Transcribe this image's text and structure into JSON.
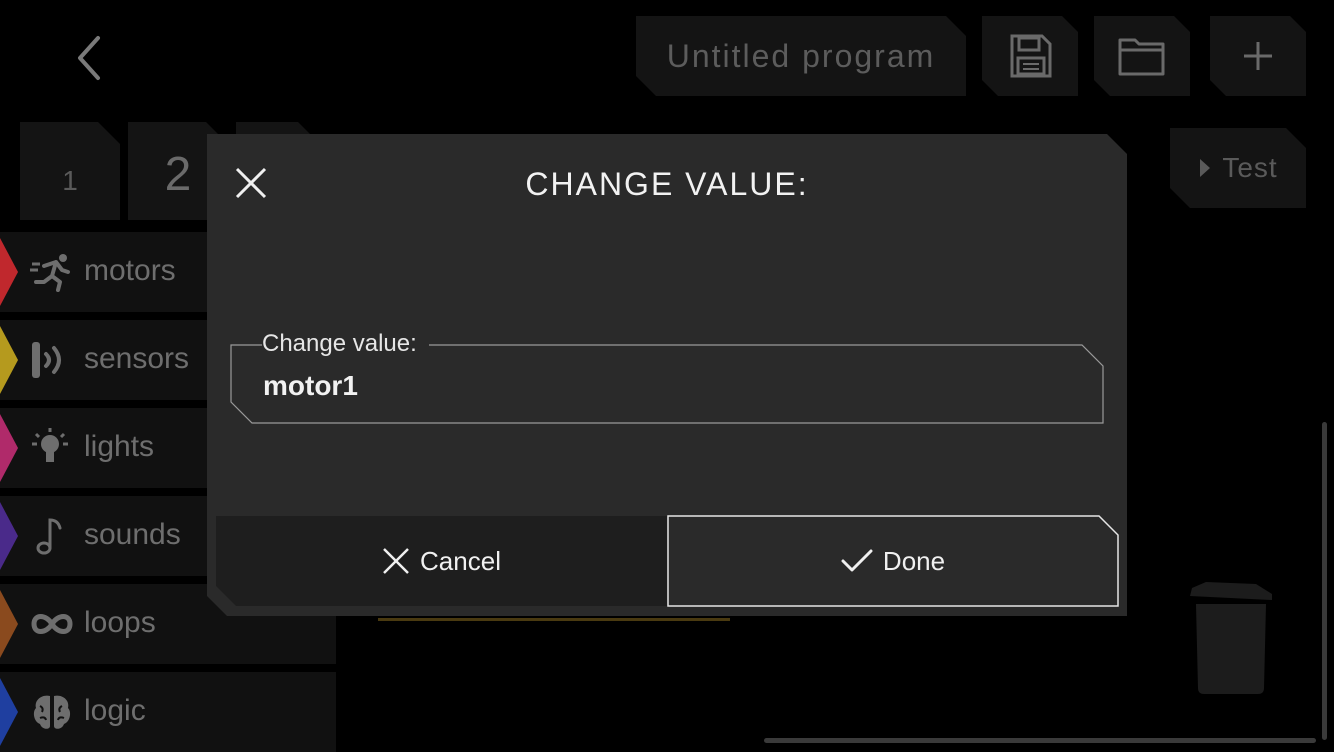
{
  "header": {
    "program_title": "Untitled program",
    "back_icon": "chevron-left-icon",
    "save_icon": "floppy-disk-icon",
    "open_icon": "folder-icon",
    "add_icon": "plus-icon"
  },
  "tabs": [
    {
      "label": "1"
    },
    {
      "label": "2"
    }
  ],
  "test_button": {
    "label": "Test",
    "icon": "play-icon"
  },
  "categories": [
    {
      "label": "motors",
      "icon": "running-person-icon",
      "color": "#c0282d"
    },
    {
      "label": "sensors",
      "icon": "sensor-icon",
      "color": "#b59a1e"
    },
    {
      "label": "lights",
      "icon": "light-bulb-icon",
      "color": "#b02a6a"
    },
    {
      "label": "sounds",
      "icon": "music-note-icon",
      "color": "#4a2a8a"
    },
    {
      "label": "loops",
      "icon": "infinity-icon",
      "color": "#8a4a1e"
    },
    {
      "label": "logic",
      "icon": "brain-icon",
      "color": "#1f3fa0"
    }
  ],
  "dialog": {
    "title": "CHANGE VALUE:",
    "field_label": "Change value:",
    "field_value": "motor1",
    "cancel_label": "Cancel",
    "done_label": "Done"
  },
  "colors": {
    "background": "#000000",
    "panel": "#141414",
    "dialog": "#2a2a2a"
  }
}
